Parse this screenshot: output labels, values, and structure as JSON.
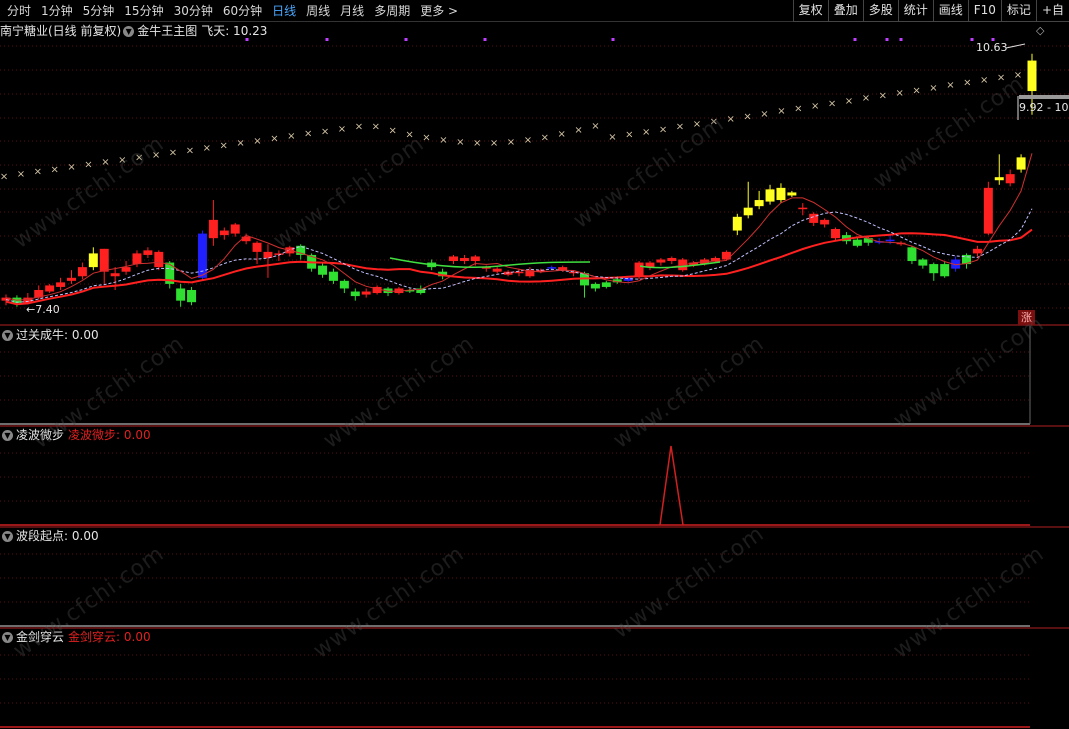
{
  "toolbar": {
    "periods": [
      "分时",
      "1分钟",
      "5分钟",
      "15分钟",
      "30分钟",
      "60分钟",
      "日线",
      "周线",
      "月线",
      "多周期",
      "更多 >"
    ],
    "active_period": "日线",
    "buttons": [
      "复权",
      "叠加",
      "多股",
      "统计",
      "画线",
      "F10",
      "标记",
      "+自"
    ]
  },
  "main_panel": {
    "stock_title": "南宁糖业(日线 前复权)",
    "indicator_name": "金牛王主图",
    "indicator_value_label": "飞天: 10.23",
    "high_label": "10.63",
    "low_label": "7.40",
    "range_label": "9.92 - 10",
    "badge": "涨",
    "diamond": "◇"
  },
  "sub_panels": [
    {
      "name": "过关成牛",
      "value_label": ": 0.00",
      "extra": ""
    },
    {
      "name": "凌波微步",
      "value_label": "",
      "extra": "凌波微步: 0.00"
    },
    {
      "name": "波段起点",
      "value_label": ": 0.00",
      "extra": ""
    },
    {
      "name": "金剑穿云",
      "value_label": "",
      "extra": "金剑穿云: 0.00"
    }
  ],
  "watermark": "www.cfchi.com",
  "colors": {
    "up": "#ff2020",
    "down": "#30e030",
    "blue": "#2020ff",
    "yellow": "#ffff20",
    "ma_red": "#ff2020",
    "ma_white": "#ffffff",
    "cross": "#d8c8a8",
    "magenta": "#c040ff",
    "panel_line": "#b02020"
  },
  "chart_data": {
    "type": "candlestick",
    "price_range": [
      7.2,
      10.9
    ],
    "candles": [
      {
        "o": 7.48,
        "c": 7.52,
        "h": 7.56,
        "l": 7.42,
        "col": "up"
      },
      {
        "o": 7.52,
        "c": 7.45,
        "h": 7.55,
        "l": 7.4,
        "col": "down"
      },
      {
        "o": 7.45,
        "c": 7.52,
        "h": 7.58,
        "l": 7.43,
        "col": "up"
      },
      {
        "o": 7.52,
        "c": 7.62,
        "h": 7.68,
        "l": 7.5,
        "col": "up"
      },
      {
        "o": 7.6,
        "c": 7.68,
        "h": 7.7,
        "l": 7.58,
        "col": "up"
      },
      {
        "o": 7.66,
        "c": 7.72,
        "h": 7.78,
        "l": 7.62,
        "col": "up"
      },
      {
        "o": 7.74,
        "c": 7.78,
        "h": 7.88,
        "l": 7.7,
        "col": "up"
      },
      {
        "o": 7.8,
        "c": 7.92,
        "h": 7.98,
        "l": 7.76,
        "col": "up"
      },
      {
        "o": 7.92,
        "c": 8.1,
        "h": 8.18,
        "l": 7.88,
        "col": "yellow"
      },
      {
        "o": 8.16,
        "c": 7.86,
        "h": 8.16,
        "l": 7.7,
        "col": "up"
      },
      {
        "o": 7.8,
        "c": 7.84,
        "h": 7.92,
        "l": 7.62,
        "col": "up"
      },
      {
        "o": 7.86,
        "c": 7.92,
        "h": 8.0,
        "l": 7.82,
        "col": "up"
      },
      {
        "o": 7.96,
        "c": 8.1,
        "h": 8.14,
        "l": 7.92,
        "col": "up"
      },
      {
        "o": 8.08,
        "c": 8.14,
        "h": 8.18,
        "l": 8.04,
        "col": "up"
      },
      {
        "o": 8.12,
        "c": 7.92,
        "h": 8.14,
        "l": 7.88,
        "col": "up"
      },
      {
        "o": 7.98,
        "c": 7.7,
        "h": 8.0,
        "l": 7.64,
        "col": "down"
      },
      {
        "o": 7.64,
        "c": 7.48,
        "h": 7.7,
        "l": 7.4,
        "col": "down"
      },
      {
        "o": 7.46,
        "c": 7.62,
        "h": 7.66,
        "l": 7.42,
        "col": "down"
      },
      {
        "o": 7.78,
        "c": 8.36,
        "h": 8.4,
        "l": 7.74,
        "col": "blue"
      },
      {
        "o": 8.54,
        "c": 8.3,
        "h": 8.8,
        "l": 8.2,
        "col": "up"
      },
      {
        "o": 8.34,
        "c": 8.4,
        "h": 8.44,
        "l": 8.28,
        "col": "up"
      },
      {
        "o": 8.48,
        "c": 8.36,
        "h": 8.5,
        "l": 8.32,
        "col": "up"
      },
      {
        "o": 8.32,
        "c": 8.26,
        "h": 8.36,
        "l": 8.22,
        "col": "up"
      },
      {
        "o": 8.24,
        "c": 8.12,
        "h": 8.26,
        "l": 7.96,
        "col": "up"
      },
      {
        "o": 8.12,
        "c": 8.04,
        "h": 8.22,
        "l": 7.78,
        "col": "up"
      },
      {
        "o": 8.1,
        "c": 8.1,
        "h": 8.14,
        "l": 8.0,
        "col": "up"
      },
      {
        "o": 8.1,
        "c": 8.18,
        "h": 8.2,
        "l": 8.06,
        "col": "up"
      },
      {
        "o": 8.2,
        "c": 8.08,
        "h": 8.22,
        "l": 8.02,
        "col": "down"
      },
      {
        "o": 8.08,
        "c": 7.9,
        "h": 8.1,
        "l": 7.86,
        "col": "down"
      },
      {
        "o": 7.94,
        "c": 7.82,
        "h": 7.98,
        "l": 7.78,
        "col": "down"
      },
      {
        "o": 7.86,
        "c": 7.74,
        "h": 7.9,
        "l": 7.7,
        "col": "down"
      },
      {
        "o": 7.74,
        "c": 7.64,
        "h": 7.76,
        "l": 7.58,
        "col": "down"
      },
      {
        "o": 7.6,
        "c": 7.54,
        "h": 7.64,
        "l": 7.48,
        "col": "down"
      },
      {
        "o": 7.56,
        "c": 7.6,
        "h": 7.64,
        "l": 7.52,
        "col": "up"
      },
      {
        "o": 7.58,
        "c": 7.66,
        "h": 7.68,
        "l": 7.56,
        "col": "up"
      },
      {
        "o": 7.64,
        "c": 7.58,
        "h": 7.66,
        "l": 7.54,
        "col": "down"
      },
      {
        "o": 7.58,
        "c": 7.64,
        "h": 7.66,
        "l": 7.56,
        "col": "up"
      },
      {
        "o": 7.62,
        "c": 7.62,
        "h": 7.64,
        "l": 7.58,
        "col": "down"
      },
      {
        "o": 7.58,
        "c": 7.64,
        "h": 7.68,
        "l": 7.56,
        "col": "down"
      },
      {
        "o": 7.92,
        "c": 7.98,
        "h": 8.02,
        "l": 7.88,
        "col": "down"
      },
      {
        "o": 7.86,
        "c": 7.8,
        "h": 7.9,
        "l": 7.76,
        "col": "down"
      },
      {
        "o": 8.0,
        "c": 8.06,
        "h": 8.08,
        "l": 7.96,
        "col": "up"
      },
      {
        "o": 8.04,
        "c": 8.0,
        "h": 8.08,
        "l": 7.96,
        "col": "up"
      },
      {
        "o": 8.06,
        "c": 8.0,
        "h": 8.08,
        "l": 7.94,
        "col": "up"
      },
      {
        "o": 7.9,
        "c": 7.92,
        "h": 7.94,
        "l": 7.86,
        "col": "up"
      },
      {
        "o": 7.9,
        "c": 7.86,
        "h": 7.92,
        "l": 7.84,
        "col": "up"
      },
      {
        "o": 7.86,
        "c": 7.82,
        "h": 7.88,
        "l": 7.8,
        "col": "up"
      },
      {
        "o": 7.84,
        "c": 7.86,
        "h": 7.9,
        "l": 7.8,
        "col": "up"
      },
      {
        "o": 7.8,
        "c": 7.88,
        "h": 7.92,
        "l": 7.78,
        "col": "up"
      },
      {
        "o": 7.88,
        "c": 7.86,
        "h": 7.9,
        "l": 7.84,
        "col": "up"
      },
      {
        "o": 7.9,
        "c": 7.92,
        "h": 7.94,
        "l": 7.88,
        "col": "blue"
      },
      {
        "o": 7.92,
        "c": 7.88,
        "h": 7.94,
        "l": 7.86,
        "col": "up"
      },
      {
        "o": 7.86,
        "c": 7.84,
        "h": 7.88,
        "l": 7.8,
        "col": "up"
      },
      {
        "o": 7.84,
        "c": 7.68,
        "h": 7.86,
        "l": 7.52,
        "col": "down"
      },
      {
        "o": 7.7,
        "c": 7.64,
        "h": 7.72,
        "l": 7.6,
        "col": "down"
      },
      {
        "o": 7.66,
        "c": 7.72,
        "h": 7.74,
        "l": 7.64,
        "col": "down"
      },
      {
        "o": 7.72,
        "c": 7.76,
        "h": 7.8,
        "l": 7.7,
        "col": "down"
      },
      {
        "o": 7.74,
        "c": 7.78,
        "h": 7.8,
        "l": 7.72,
        "col": "blue"
      },
      {
        "o": 7.98,
        "c": 7.8,
        "h": 8.0,
        "l": 7.76,
        "col": "up"
      },
      {
        "o": 7.92,
        "c": 7.98,
        "h": 8.0,
        "l": 7.88,
        "col": "up"
      },
      {
        "o": 7.98,
        "c": 8.02,
        "h": 8.04,
        "l": 7.94,
        "col": "up"
      },
      {
        "o": 8.0,
        "c": 8.04,
        "h": 8.06,
        "l": 7.96,
        "col": "up"
      },
      {
        "o": 8.02,
        "c": 7.88,
        "h": 8.04,
        "l": 7.86,
        "col": "up"
      },
      {
        "o": 7.94,
        "c": 7.98,
        "h": 8.0,
        "l": 7.92,
        "col": "up"
      },
      {
        "o": 7.96,
        "c": 8.02,
        "h": 8.04,
        "l": 7.94,
        "col": "up"
      },
      {
        "o": 8.0,
        "c": 8.04,
        "h": 8.06,
        "l": 7.98,
        "col": "up"
      },
      {
        "o": 8.02,
        "c": 8.12,
        "h": 8.14,
        "l": 8.0,
        "col": "up"
      },
      {
        "o": 8.4,
        "c": 8.58,
        "h": 8.62,
        "l": 8.34,
        "col": "yellow"
      },
      {
        "o": 8.6,
        "c": 8.7,
        "h": 9.04,
        "l": 8.56,
        "col": "yellow"
      },
      {
        "o": 8.72,
        "c": 8.8,
        "h": 8.92,
        "l": 8.68,
        "col": "yellow"
      },
      {
        "o": 8.78,
        "c": 8.94,
        "h": 9.0,
        "l": 8.74,
        "col": "yellow"
      },
      {
        "o": 8.96,
        "c": 8.8,
        "h": 9.02,
        "l": 8.76,
        "col": "yellow"
      },
      {
        "o": 8.86,
        "c": 8.9,
        "h": 8.92,
        "l": 8.84,
        "col": "yellow"
      },
      {
        "o": 8.68,
        "c": 8.7,
        "h": 8.76,
        "l": 8.6,
        "col": "up"
      },
      {
        "o": 8.62,
        "c": 8.5,
        "h": 8.64,
        "l": 8.46,
        "col": "up"
      },
      {
        "o": 8.54,
        "c": 8.48,
        "h": 8.56,
        "l": 8.44,
        "col": "up"
      },
      {
        "o": 8.42,
        "c": 8.3,
        "h": 8.44,
        "l": 8.26,
        "col": "up"
      },
      {
        "o": 8.34,
        "c": 8.26,
        "h": 8.38,
        "l": 8.22,
        "col": "down"
      },
      {
        "o": 8.28,
        "c": 8.2,
        "h": 8.32,
        "l": 8.18,
        "col": "down"
      },
      {
        "o": 8.3,
        "c": 8.24,
        "h": 8.32,
        "l": 8.2,
        "col": "down"
      },
      {
        "o": 8.26,
        "c": 8.26,
        "h": 8.3,
        "l": 8.22,
        "col": "blue"
      },
      {
        "o": 8.28,
        "c": 8.26,
        "h": 8.34,
        "l": 8.22,
        "col": "blue"
      },
      {
        "o": 8.24,
        "c": 8.22,
        "h": 8.26,
        "l": 8.2,
        "col": "up"
      },
      {
        "o": 8.18,
        "c": 8.0,
        "h": 8.2,
        "l": 7.96,
        "col": "down"
      },
      {
        "o": 8.02,
        "c": 7.94,
        "h": 8.04,
        "l": 7.9,
        "col": "down"
      },
      {
        "o": 7.96,
        "c": 7.84,
        "h": 7.98,
        "l": 7.74,
        "col": "down"
      },
      {
        "o": 7.8,
        "c": 7.96,
        "h": 8.0,
        "l": 7.78,
        "col": "down"
      },
      {
        "o": 7.9,
        "c": 8.02,
        "h": 8.06,
        "l": 7.86,
        "col": "blue"
      },
      {
        "o": 7.96,
        "c": 8.08,
        "h": 8.1,
        "l": 7.9,
        "col": "down"
      },
      {
        "o": 8.1,
        "c": 8.16,
        "h": 8.2,
        "l": 8.06,
        "col": "up"
      },
      {
        "o": 8.36,
        "c": 8.96,
        "h": 9.04,
        "l": 8.34,
        "col": "up"
      },
      {
        "o": 9.06,
        "c": 9.1,
        "h": 9.4,
        "l": 9.0,
        "col": "yellow"
      },
      {
        "o": 9.14,
        "c": 9.02,
        "h": 9.2,
        "l": 8.98,
        "col": "up"
      },
      {
        "o": 9.2,
        "c": 9.36,
        "h": 9.4,
        "l": 9.16,
        "col": "yellow"
      },
      {
        "o": 10.23,
        "c": 10.63,
        "h": 10.72,
        "l": 9.92,
        "col": "yellow"
      }
    ]
  }
}
